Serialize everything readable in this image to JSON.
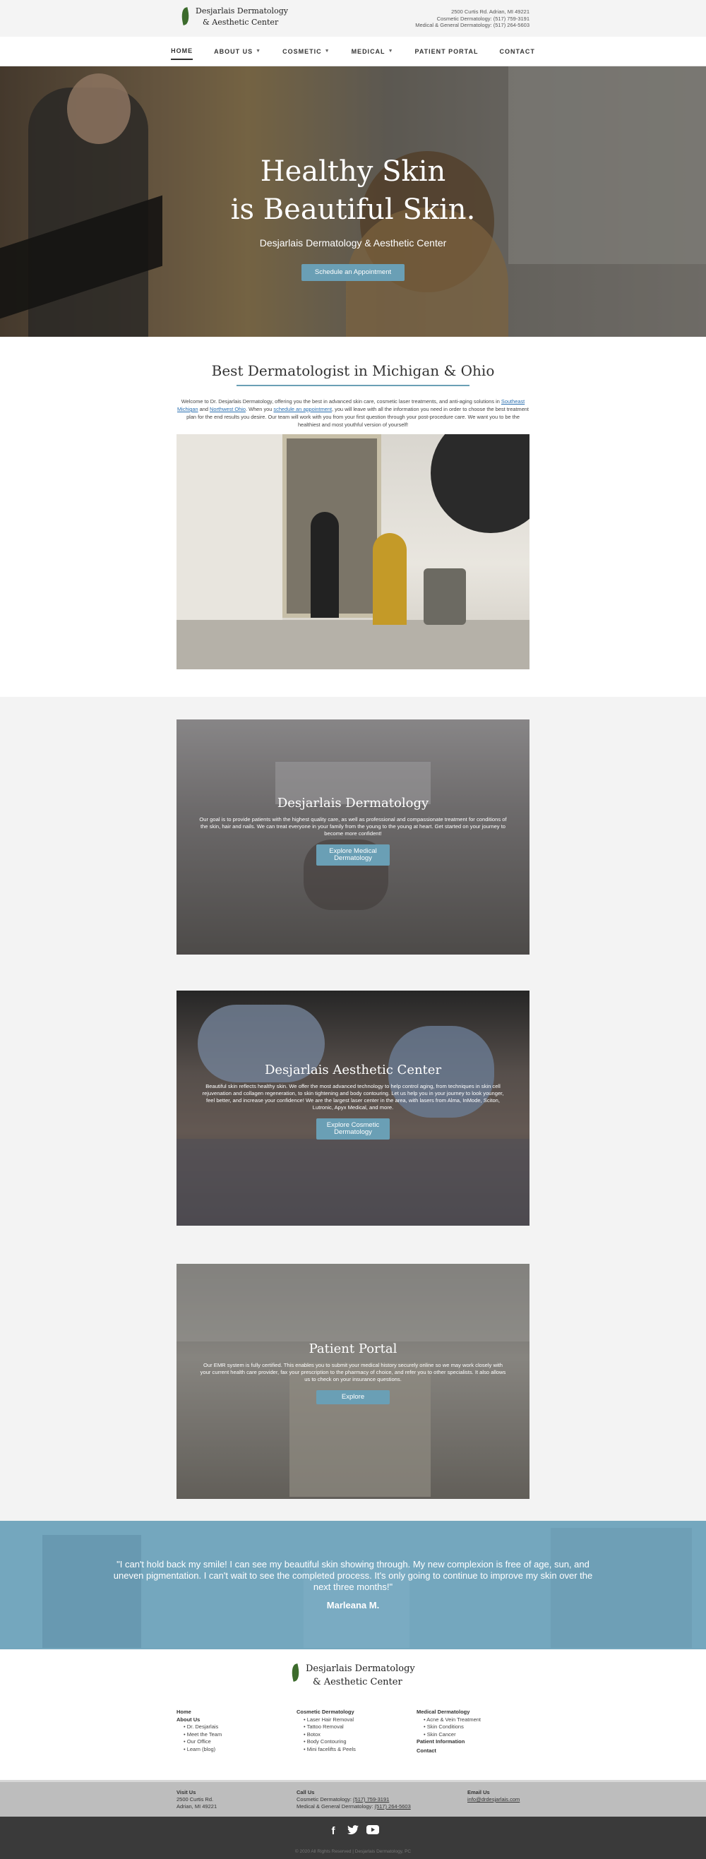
{
  "header": {
    "logo_line1": "Desjarlais Dermatology",
    "logo_line2": "& Aesthetic Center",
    "address": "2500 Curtis Rd. Adrian, MI 49221",
    "cosmetic_phone": "Cosmetic Dermatology: (517) 759-3191",
    "medical_phone": "Medical & General Dermatology: (517) 264-5603"
  },
  "nav": {
    "items": [
      {
        "label": "HOME",
        "dropdown": false,
        "active": true
      },
      {
        "label": "ABOUT US",
        "dropdown": true
      },
      {
        "label": "COSMETIC",
        "dropdown": true
      },
      {
        "label": "MEDICAL",
        "dropdown": true
      },
      {
        "label": "PATIENT PORTAL",
        "dropdown": false
      },
      {
        "label": "CONTACT",
        "dropdown": false
      }
    ]
  },
  "hero": {
    "title_line1": "Healthy Skin",
    "title_line2": "is Beautiful Skin.",
    "subtitle": "Desjarlais Dermatology & Aesthetic Center",
    "button": "Schedule an Appointment"
  },
  "intro": {
    "heading": "Best Dermatologist in Michigan & Ohio",
    "text_a": "Welcome to Dr. Desjarlais Dermatology, offering you the best in advanced skin care, cosmetic laser treatments, and anti-aging solutions in ",
    "link_1": "Southeast Michigan",
    "text_b": " and ",
    "link_2": "Northwest Ohio",
    "text_c": ". When you ",
    "link_3": "schedule an appointment",
    "text_d": ", you will leave with all the information you need in order to choose the best treatment plan for the end results you desire. Our team will work with you from your first question through your post-procedure care. We want you to be the healthiest and most youthful version of yourself!"
  },
  "cards": [
    {
      "title": "Desjarlais Dermatology",
      "text": "Our goal is to provide patients with the highest quality care, as well as professional and compassionate treatment for conditions of the skin, hair and nails. We can treat everyone in your family from the young to the young at heart. Get started on your journey to become more confident!",
      "button_line1": "Explore Medical",
      "button_line2": "Dermatology"
    },
    {
      "title": "Desjarlais Aesthetic Center",
      "text": "Beautiful skin reflects healthy skin. We offer the most advanced technology to help control aging, from techniques in skin cell rejuvenation and collagen regeneration, to skin tightening and body contouring. Let us help you in your journey to look younger, feel better, and increase your confidence! We are the largest laser center in the area, with lasers from Alma, InMode, Sciton, Lutronic, Apyx Medical, and more.",
      "button_line1": "Explore Cosmetic",
      "button_line2": "Dermatology"
    },
    {
      "title": "Patient Portal",
      "text": "Our EMR system is fully certified. This enables you to submit your medical history securely online so we may work closely with your current health care provider, fax your prescription to the pharmacy of choice, and refer you to other specialists. It also allows us to check on your insurance questions.",
      "button_line1": "Explore",
      "button_line2": ""
    }
  ],
  "testimonial": {
    "quote": "\"I can't hold back my smile! I can see my beautiful skin showing through. My new complexion is free of age, sun, and uneven pigmentation. I can't wait to see the completed process. It's only going to continue to improve my skin over the next three months!\"",
    "author": "Marleana M."
  },
  "footer": {
    "col1": {
      "home": "Home",
      "about": "About Us",
      "items": [
        "Dr. Desjarlais",
        "Meet the Team",
        "Our Office",
        "Learn (blog)"
      ]
    },
    "col2": {
      "heading": "Cosmetic Dermatology",
      "items": [
        "Laser Hair Removal",
        "Tattoo Removal",
        "Botox",
        "Body Contouring",
        "Mini facelifts & Peels"
      ]
    },
    "col3": {
      "heading": "Medical Dermatology",
      "items": [
        "Acne & Vein Treatment",
        "Skin Conditions",
        "Skin Cancer"
      ],
      "portal": "Patient Information",
      "contact": "Contact"
    },
    "visit_heading": "Visit Us",
    "visit_line1": "2500 Curtis Rd.",
    "visit_line2": "Adrian, MI 49221",
    "call_heading": "Call Us",
    "call_cosmetic_label": "Cosmetic Dermatology: ",
    "call_cosmetic": "(517) 759-3191",
    "call_medical_label": "Medical & General Dermatology: ",
    "call_medical": "(517) 264-5603",
    "email_heading": "Email Us",
    "email": "info@drdesjarlais.com",
    "copyright": "© 2020 All Rights Reserved | Desjarlais Dermatology, PC"
  },
  "social": [
    "facebook-icon",
    "twitter-icon",
    "youtube-icon"
  ],
  "colors": {
    "accent": "#6a9fb5",
    "testimonial_bg": "#74a7be",
    "footer_dark": "#3a3a3a"
  }
}
